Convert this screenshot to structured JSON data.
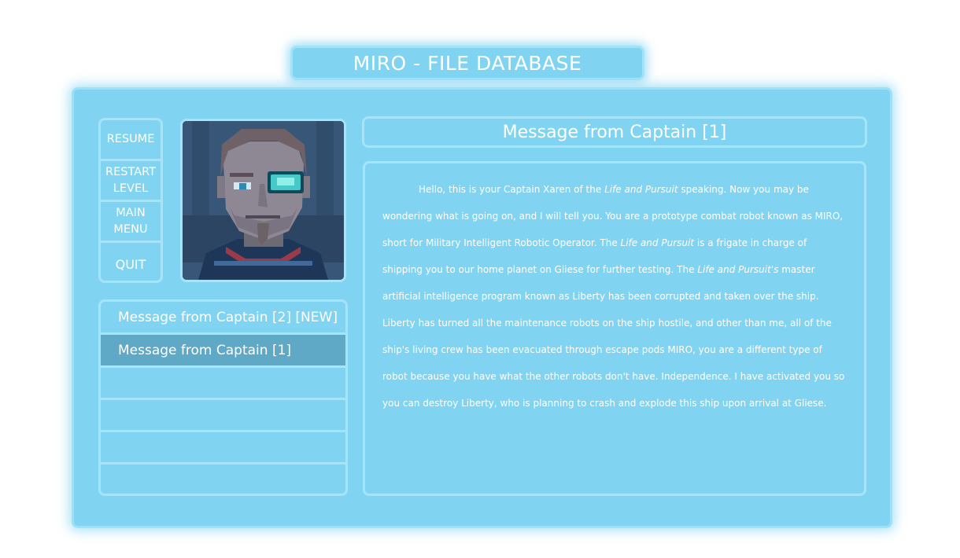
{
  "window": {
    "title": "MIRO - FILE DATABASE"
  },
  "menu": {
    "resume": "RESUME",
    "restart": "RESTART LEVEL",
    "main_menu": "MAIN MENU",
    "quit": "QUIT"
  },
  "messages": [
    {
      "label": "Message from Captain [2] [NEW]"
    },
    {
      "label": "Message from Captain [1]"
    }
  ],
  "message_view": {
    "title": "Message from Captain [1]",
    "body": [
      {
        "text": "Hello, this is your Captain Xaren of the ",
        "italic": false
      },
      {
        "text": "Life and Pursuit",
        "italic": true
      },
      {
        "text": " speaking. Now you may be wondering what is going on, and I will tell you. You are a prototype combat robot known as MIRO, short for Military Intelligent Robotic Operator. The ",
        "italic": false
      },
      {
        "text": "Life and Pursuit",
        "italic": true
      },
      {
        "text": " is a frigate in charge of shipping you to our home planet on Gliese for further testing. The ",
        "italic": false
      },
      {
        "text": "Life and Pursuit's",
        "italic": true
      },
      {
        "text": " master artificial intelligence program known as Liberty has been corrupted and taken over the ship. Liberty has turned all the maintenance robots on the ship hostile, and other than me, all of the ship's living crew has been evacuated through escape pods MIRO, you are a different type of robot because you have what the other robots don't have. Independence. I have activated you so you can destroy Liberty, who is planning to crash and explode this ship upon arrival at Gliese.",
        "italic": false
      }
    ]
  },
  "colors": {
    "panel": "#80d4f1",
    "border": "#a6e4fa",
    "selected": "#5fa8c6",
    "text": "#ffffff"
  },
  "icons": {
    "portrait": "captain-portrait"
  }
}
